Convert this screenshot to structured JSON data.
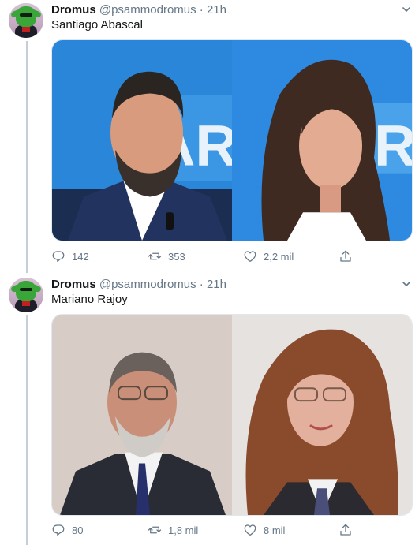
{
  "tweets": [
    {
      "author": {
        "name": "Dromus",
        "handle": "@psammodromus"
      },
      "separator": "·",
      "time": "21h",
      "text": "Santiago Abascal",
      "actions": {
        "replies": "142",
        "retweets": "353",
        "likes": "2,2 mil"
      }
    },
    {
      "author": {
        "name": "Dromus",
        "handle": "@psammodromus"
      },
      "separator": "·",
      "time": "21h",
      "text": "Mariano Rajoy",
      "actions": {
        "replies": "80",
        "retweets": "1,8 mil",
        "likes": "8 mil"
      }
    }
  ],
  "icons": {
    "reply": "reply-icon",
    "retweet": "retweet-icon",
    "like": "heart-icon",
    "share": "share-icon",
    "more": "chevron-down-icon"
  },
  "colors": {
    "text": "#14171a",
    "secondary": "#657786",
    "thread_line": "#c4cfd6",
    "studio_blue": "#2a86d8"
  }
}
